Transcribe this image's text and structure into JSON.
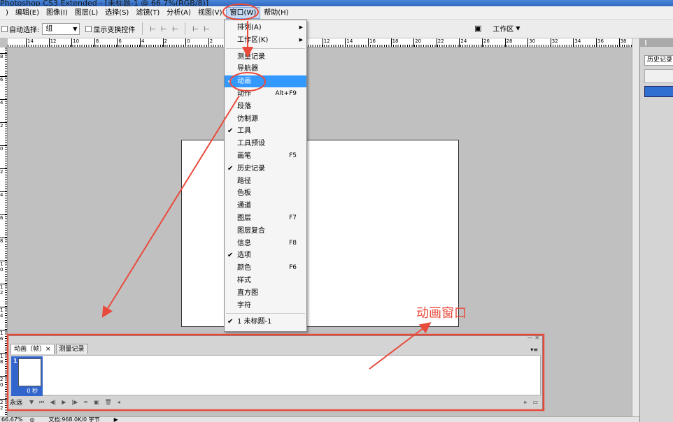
{
  "app": {
    "title": "Photoshop CS3 Extended - [未标题-1 @ 66.7%(RGB/8)]"
  },
  "menubar": {
    "items": [
      "编辑(E)",
      "图像(I)",
      "图层(L)",
      "选择(S)",
      "滤镜(T)",
      "分析(A)",
      "视图(V)",
      "窗口(W)",
      "帮助(H)"
    ],
    "active": "窗口(W)"
  },
  "optionsbar": {
    "auto_select_label": "自动选择:",
    "group_value": "组",
    "transform_label": "显示变换控件",
    "workspace_label": "工作区"
  },
  "rulers": {
    "top": [
      "14",
      "12",
      "10",
      "8",
      "6",
      "4",
      "2",
      "0",
      "2",
      "4",
      "6",
      "8",
      "10",
      "12",
      "14",
      "16",
      "18",
      "20",
      "22",
      "24",
      "26",
      "28",
      "30",
      "32",
      "34",
      "36",
      "38"
    ],
    "left": [
      "8",
      "6",
      "4",
      "2",
      "0",
      "2",
      "4",
      "6",
      "8",
      "1 0",
      "1 2",
      "1 4",
      "1 6",
      "1 8",
      "2 0",
      "2 2",
      "2 4"
    ]
  },
  "window_menu": {
    "items": [
      {
        "label": "排列(A)",
        "submenu": true
      },
      {
        "label": "工作区(K)",
        "submenu": true
      },
      {
        "label": "测量记录"
      },
      {
        "label": "导航器"
      },
      {
        "label": "动画",
        "checked": true,
        "highlighted": true
      },
      {
        "label": "动作",
        "shortcut": "Alt+F9"
      },
      {
        "label": "段落"
      },
      {
        "label": "仿制源"
      },
      {
        "label": "工具",
        "checked": true
      },
      {
        "label": "工具预设"
      },
      {
        "label": "画笔",
        "shortcut": "F5"
      },
      {
        "label": "历史记录",
        "checked": true
      },
      {
        "label": "路径"
      },
      {
        "label": "色板"
      },
      {
        "label": "通道"
      },
      {
        "label": "图层",
        "shortcut": "F7"
      },
      {
        "label": "图层复合"
      },
      {
        "label": "信息",
        "shortcut": "F8"
      },
      {
        "label": "选项",
        "checked": true
      },
      {
        "label": "颜色",
        "shortcut": "F6"
      },
      {
        "label": "样式"
      },
      {
        "label": "直方图"
      },
      {
        "label": "字符"
      },
      {
        "label": "1 未标题-1",
        "checked": true
      }
    ]
  },
  "right_panel": {
    "tab_label": "历史记录"
  },
  "animation_panel": {
    "tabs": [
      "动画（帧）×",
      "测量记录"
    ],
    "frame_number": "1",
    "frame_delay": "0 秒",
    "loop": "永远"
  },
  "statusbar": {
    "zoom": "66.67%",
    "doc_info": "文档:968.0K/0 字节"
  },
  "annotation": {
    "label": "动画窗口",
    "color": "#e84b3c"
  }
}
